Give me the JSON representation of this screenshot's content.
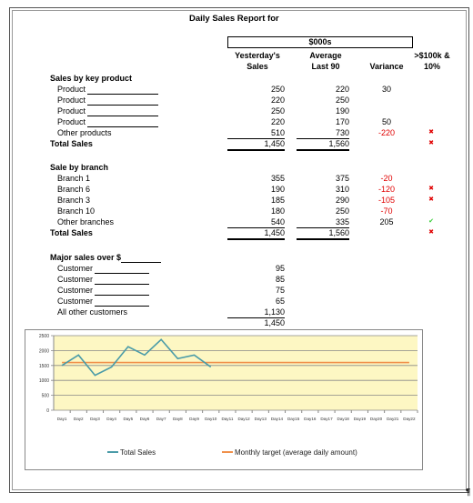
{
  "title": "Daily Sales Report for",
  "header": {
    "units": "$000s",
    "col1": [
      "Yesterday's",
      "Sales"
    ],
    "col2": [
      "Average",
      "Last 90"
    ],
    "col3": "Variance",
    "col4": [
      ">$100k &",
      "10%"
    ]
  },
  "sections": [
    {
      "heading": "Sales by key product",
      "rows": [
        {
          "label": "Product",
          "blank": true,
          "yesterday": "250",
          "average": "220",
          "variance": "30",
          "flag": ""
        },
        {
          "label": "Product",
          "blank": true,
          "yesterday": "220",
          "average": "250",
          "variance": "",
          "flag": ""
        },
        {
          "label": "Product",
          "blank": true,
          "yesterday": "250",
          "average": "190",
          "variance": "",
          "flag": ""
        },
        {
          "label": "Product",
          "blank": true,
          "yesterday": "220",
          "average": "170",
          "variance": "50",
          "flag": ""
        },
        {
          "label": "Other products",
          "yesterday": "510",
          "average": "730",
          "variance": "-220",
          "flag": "cross"
        }
      ],
      "total": {
        "label": "Total Sales",
        "yesterday": "1,450",
        "average": "1,560",
        "flag": "cross"
      }
    },
    {
      "heading": "Sale by branch",
      "rows": [
        {
          "label": "Branch 1",
          "yesterday": "355",
          "average": "375",
          "variance": "-20",
          "flag": ""
        },
        {
          "label": "Branch 6",
          "yesterday": "190",
          "average": "310",
          "variance": "-120",
          "flag": "cross"
        },
        {
          "label": "Branch 3",
          "yesterday": "185",
          "average": "290",
          "variance": "-105",
          "flag": "cross"
        },
        {
          "label": "Branch 10",
          "yesterday": "180",
          "average": "250",
          "variance": "-70",
          "flag": ""
        },
        {
          "label": "Other branches",
          "yesterday": "540",
          "average": "335",
          "variance": "205",
          "flag": "check"
        }
      ],
      "total": {
        "label": "Total Sales",
        "yesterday": "1,450",
        "average": "1,560",
        "flag": "cross"
      }
    },
    {
      "heading": "Major sales over $",
      "heading_blank": true,
      "rows": [
        {
          "label": "Customer",
          "blank": true,
          "yesterday": "95"
        },
        {
          "label": "Customer",
          "blank": true,
          "yesterday": "85"
        },
        {
          "label": "Customer",
          "blank": true,
          "yesterday": "75"
        },
        {
          "label": "Customer",
          "blank": true,
          "yesterday": "65"
        },
        {
          "label": "All other customers",
          "yesterday": "1,130"
        }
      ],
      "total": {
        "label": "",
        "yesterday": "1,450"
      }
    }
  ],
  "colors": {
    "negative": "#e00000",
    "cross": "#e00000",
    "check": "#33cc33",
    "sales_line": "#4a9ba8",
    "target_line": "#f0904a",
    "plot_bg": "#fdf7c3"
  },
  "chart_data": {
    "type": "line",
    "categories": [
      "Day1",
      "Day2",
      "Day3",
      "Day4",
      "Day5",
      "Day6",
      "Day7",
      "Day8",
      "Day9",
      "Day10",
      "Day11",
      "Day12",
      "Day13",
      "Day14",
      "Day15",
      "Day16",
      "Day17",
      "Day18",
      "Day19",
      "Day20",
      "Day21",
      "Day22"
    ],
    "series": [
      {
        "name": "Total Sales",
        "values": [
          1500,
          1850,
          1170,
          1450,
          2130,
          1850,
          2370,
          1730,
          1850,
          1450
        ]
      },
      {
        "name": "Monthly target (average daily amount)",
        "values": [
          1600,
          1600,
          1600,
          1600,
          1600,
          1600,
          1600,
          1600,
          1600,
          1600,
          1600,
          1600,
          1600,
          1600,
          1600,
          1600,
          1600,
          1600,
          1600,
          1600,
          1600,
          1600
        ]
      }
    ],
    "yticks": [
      0,
      500,
      1000,
      1500,
      2000,
      2500
    ],
    "ylim": [
      0,
      2500
    ],
    "grid": true,
    "legend": "bottom"
  }
}
